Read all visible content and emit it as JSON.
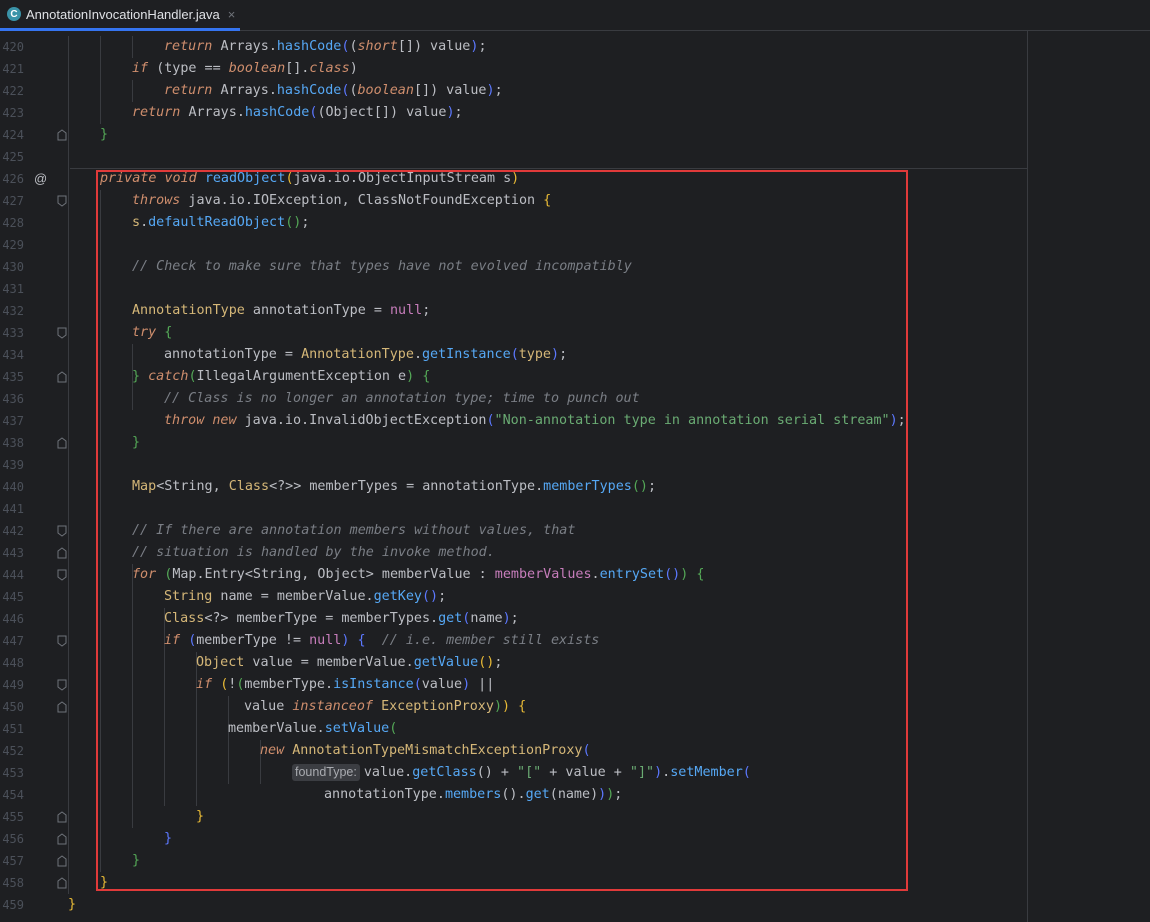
{
  "tab": {
    "label": "AnnotationInvocationHandler.java",
    "icon_letter": "C",
    "close": "×"
  },
  "gutter": {
    "override_marker": "@"
  },
  "inlay": {
    "found_type": "foundType:"
  },
  "lines": [
    {
      "n": "420",
      "indent": 2,
      "tokens": [
        [
          "return",
          "k"
        ],
        [
          " ",
          "i"
        ],
        [
          "Arrays",
          "i"
        ],
        [
          ".",
          "i"
        ],
        [
          "hashCode",
          "f"
        ],
        [
          "(",
          "b2"
        ],
        [
          "(",
          "b3"
        ],
        [
          "short",
          "k"
        ],
        [
          "[]",
          "i"
        ],
        [
          ")",
          "b3"
        ],
        [
          " value",
          ""
        ],
        [
          ")",
          "b2"
        ],
        [
          ";",
          ""
        ]
      ]
    },
    {
      "n": "421",
      "indent": 1,
      "tokens": [
        [
          "if",
          "k"
        ],
        [
          " ",
          "i"
        ],
        [
          "(",
          "b3"
        ],
        [
          "type == ",
          "i"
        ],
        [
          "boolean",
          "k"
        ],
        [
          "[].",
          "i"
        ],
        [
          "class",
          "k"
        ],
        [
          ")",
          "b3"
        ]
      ]
    },
    {
      "n": "422",
      "indent": 2,
      "tokens": [
        [
          "return",
          "k"
        ],
        [
          " ",
          "i"
        ],
        [
          "Arrays",
          "i"
        ],
        [
          ".",
          "i"
        ],
        [
          "hashCode",
          "f"
        ],
        [
          "(",
          "b2"
        ],
        [
          "(",
          "b3"
        ],
        [
          "boolean",
          "k"
        ],
        [
          "[]",
          "i"
        ],
        [
          ")",
          "b3"
        ],
        [
          " value",
          ""
        ],
        [
          ")",
          "b2"
        ],
        [
          ";",
          ""
        ]
      ]
    },
    {
      "n": "423",
      "indent": 1,
      "tokens": [
        [
          "return",
          "k"
        ],
        [
          " ",
          "i"
        ],
        [
          "Arrays",
          "i"
        ],
        [
          ".",
          "i"
        ],
        [
          "hashCode",
          "f"
        ],
        [
          "(",
          "b2"
        ],
        [
          "(",
          "b3"
        ],
        [
          "Object[]",
          "i"
        ],
        [
          ")",
          "b3"
        ],
        [
          " value",
          ""
        ],
        [
          ")",
          "b2"
        ],
        [
          ";",
          ""
        ]
      ]
    },
    {
      "n": "424",
      "indent": 0,
      "tokens": [
        [
          "}",
          "b1"
        ]
      ]
    },
    {
      "n": "425",
      "indent": 0,
      "tokens": []
    },
    {
      "n": "426",
      "indent": 0,
      "tokens": [
        [
          "private",
          "k"
        ],
        [
          " ",
          "i"
        ],
        [
          "void",
          "k"
        ],
        [
          " ",
          "i"
        ],
        [
          "readObject",
          "f"
        ],
        [
          "(",
          "b0"
        ],
        [
          "java.io.ObjectInputStream s",
          "i"
        ],
        [
          ")",
          "b0"
        ]
      ]
    },
    {
      "n": "427",
      "indent": 1,
      "tokens": [
        [
          "throws",
          "k"
        ],
        [
          " java.io.IOException, ClassNotFoundException ",
          "i"
        ],
        [
          "{",
          "b0"
        ]
      ]
    },
    {
      "n": "428",
      "indent": 1,
      "tokens": [
        [
          "s",
          "t"
        ],
        [
          ".",
          "i"
        ],
        [
          "defaultReadObject",
          "f"
        ],
        [
          "()",
          "b1"
        ],
        [
          ";",
          ""
        ]
      ]
    },
    {
      "n": "429",
      "indent": 0,
      "tokens": []
    },
    {
      "n": "430",
      "indent": 1,
      "tokens": [
        [
          "// Check to make sure that types have not evolved incompatibly",
          "c"
        ]
      ]
    },
    {
      "n": "431",
      "indent": 0,
      "tokens": []
    },
    {
      "n": "432",
      "indent": 1,
      "tokens": [
        [
          "AnnotationType",
          "t"
        ],
        [
          " annotationType = ",
          "i"
        ],
        [
          "null",
          "v"
        ],
        [
          ";",
          ""
        ]
      ]
    },
    {
      "n": "433",
      "indent": 1,
      "tokens": [
        [
          "try",
          "k"
        ],
        [
          " ",
          "i"
        ],
        [
          "{",
          "b1"
        ]
      ]
    },
    {
      "n": "434",
      "indent": 2,
      "tokens": [
        [
          "annotationType = ",
          "i"
        ],
        [
          "AnnotationType",
          "t"
        ],
        [
          ".",
          "i"
        ],
        [
          "getInstance",
          "f"
        ],
        [
          "(",
          "b2"
        ],
        [
          "type",
          "t"
        ],
        [
          ")",
          "b2"
        ],
        [
          ";",
          ""
        ]
      ]
    },
    {
      "n": "435",
      "indent": 1,
      "tokens": [
        [
          "}",
          "b1"
        ],
        [
          " ",
          "i"
        ],
        [
          "catch",
          "k"
        ],
        [
          "(",
          "b1"
        ],
        [
          "IllegalArgumentException e",
          "i"
        ],
        [
          ")",
          "b1"
        ],
        [
          " ",
          "i"
        ],
        [
          "{",
          "b1"
        ]
      ]
    },
    {
      "n": "436",
      "indent": 2,
      "tokens": [
        [
          "// Class is no longer an annotation type; time to punch out",
          "c"
        ]
      ]
    },
    {
      "n": "437",
      "indent": 2,
      "tokens": [
        [
          "throw",
          "k"
        ],
        [
          " ",
          "i"
        ],
        [
          "new",
          "k"
        ],
        [
          " java.io.InvalidObjectException",
          "i"
        ],
        [
          "(",
          "b2"
        ],
        [
          "\"Non-annotation type in annotation serial stream\"",
          "s"
        ],
        [
          ")",
          "b2"
        ],
        [
          ";",
          ""
        ]
      ]
    },
    {
      "n": "438",
      "indent": 1,
      "tokens": [
        [
          "}",
          "b1"
        ]
      ]
    },
    {
      "n": "439",
      "indent": 0,
      "tokens": []
    },
    {
      "n": "440",
      "indent": 1,
      "tokens": [
        [
          "Map",
          "t"
        ],
        [
          "<String, ",
          "i"
        ],
        [
          "Class",
          "t"
        ],
        [
          "<?>> memberTypes = annotationType.",
          "i"
        ],
        [
          "memberTypes",
          "f"
        ],
        [
          "()",
          "b1"
        ],
        [
          ";",
          ""
        ]
      ]
    },
    {
      "n": "441",
      "indent": 0,
      "tokens": []
    },
    {
      "n": "442",
      "indent": 1,
      "tokens": [
        [
          "// If there are annotation members without values, that",
          "c"
        ]
      ]
    },
    {
      "n": "443",
      "indent": 1,
      "tokens": [
        [
          "// situation is handled by the invoke method.",
          "c"
        ]
      ]
    },
    {
      "n": "444",
      "indent": 1,
      "tokens": [
        [
          "for",
          "k"
        ],
        [
          " ",
          "i"
        ],
        [
          "(",
          "b1"
        ],
        [
          "Map.Entry<String, Object> memberValue : ",
          "i"
        ],
        [
          "memberValues",
          "v"
        ],
        [
          ".",
          "i"
        ],
        [
          "entrySet",
          "f"
        ],
        [
          "()",
          "b2"
        ],
        [
          ")",
          "b1"
        ],
        [
          " ",
          "i"
        ],
        [
          "{",
          "b1"
        ]
      ]
    },
    {
      "n": "445",
      "indent": 2,
      "tokens": [
        [
          "String",
          "t"
        ],
        [
          " name = memberValue.",
          "i"
        ],
        [
          "getKey",
          "f"
        ],
        [
          "()",
          "b2"
        ],
        [
          ";",
          ""
        ]
      ]
    },
    {
      "n": "446",
      "indent": 2,
      "tokens": [
        [
          "Class",
          "t"
        ],
        [
          "<?> memberType = memberTypes.",
          "i"
        ],
        [
          "get",
          "f"
        ],
        [
          "(",
          "b2"
        ],
        [
          "name",
          "i"
        ],
        [
          ")",
          "b2"
        ],
        [
          ";",
          ""
        ]
      ]
    },
    {
      "n": "447",
      "indent": 2,
      "tokens": [
        [
          "if",
          "k"
        ],
        [
          " ",
          "i"
        ],
        [
          "(",
          "b2"
        ],
        [
          "memberType != ",
          "i"
        ],
        [
          "null",
          "v"
        ],
        [
          ")",
          "b2"
        ],
        [
          " ",
          "i"
        ],
        [
          "{",
          "b2"
        ],
        [
          "  ",
          "i"
        ],
        [
          "// i.e. member still exists",
          "c"
        ]
      ]
    },
    {
      "n": "448",
      "indent": 3,
      "tokens": [
        [
          "Object",
          "t"
        ],
        [
          " value = memberValue.",
          "i"
        ],
        [
          "getValue",
          "f"
        ],
        [
          "()",
          "b0"
        ],
        [
          ";",
          ""
        ]
      ]
    },
    {
      "n": "449",
      "indent": 3,
      "tokens": [
        [
          "if",
          "k"
        ],
        [
          " ",
          "i"
        ],
        [
          "(",
          "b0"
        ],
        [
          "!",
          "i"
        ],
        [
          "(",
          "b1"
        ],
        [
          "memberType.",
          "i"
        ],
        [
          "isInstance",
          "f"
        ],
        [
          "(",
          "b2"
        ],
        [
          "value",
          "i"
        ],
        [
          ")",
          "b2"
        ],
        [
          " ||",
          "i"
        ]
      ]
    },
    {
      "n": "450",
      "indent": 3,
      "extra": 48,
      "tokens": [
        [
          "value ",
          "i"
        ],
        [
          "instanceof",
          "k"
        ],
        [
          " ",
          "i"
        ],
        [
          "ExceptionProxy",
          "t"
        ],
        [
          ")",
          "b1"
        ],
        [
          ")",
          "b0"
        ],
        [
          " ",
          "i"
        ],
        [
          "{",
          "b0"
        ]
      ]
    },
    {
      "n": "451",
      "indent": 4,
      "tokens": [
        [
          "memberValue.",
          "i"
        ],
        [
          "setValue",
          "f"
        ],
        [
          "(",
          "b1"
        ]
      ]
    },
    {
      "n": "452",
      "indent": 5,
      "tokens": [
        [
          "new",
          "k"
        ],
        [
          " ",
          "i"
        ],
        [
          "AnnotationTypeMismatchExceptionProxy",
          "t"
        ],
        [
          "(",
          "b2"
        ]
      ]
    },
    {
      "n": "453",
      "indent": 6,
      "hint": true,
      "tokens": [
        [
          "value.",
          "i"
        ],
        [
          "getClass",
          "f"
        ],
        [
          "()",
          "b3"
        ],
        [
          " + ",
          "i"
        ],
        [
          "\"[\"",
          "s"
        ],
        [
          " + value + ",
          "i"
        ],
        [
          "\"]\"",
          "s"
        ],
        [
          ")",
          "b2"
        ],
        [
          ".",
          "i"
        ],
        [
          "setMember",
          "f"
        ],
        [
          "(",
          "b2"
        ]
      ]
    },
    {
      "n": "454",
      "indent": 7,
      "tokens": [
        [
          "annotationType.",
          "i"
        ],
        [
          "members",
          "f"
        ],
        [
          "()",
          "b3"
        ],
        [
          ".",
          "i"
        ],
        [
          "get",
          "f"
        ],
        [
          "(",
          "b3"
        ],
        [
          "name",
          "i"
        ],
        [
          ")",
          "b3"
        ],
        [
          ")",
          "b2"
        ],
        [
          ")",
          "b1"
        ],
        [
          ";",
          ""
        ]
      ]
    },
    {
      "n": "455",
      "indent": 3,
      "tokens": [
        [
          "}",
          "b0"
        ]
      ]
    },
    {
      "n": "456",
      "indent": 2,
      "tokens": [
        [
          "}",
          "b2"
        ]
      ]
    },
    {
      "n": "457",
      "indent": 1,
      "tokens": [
        [
          "}",
          "b1"
        ]
      ]
    },
    {
      "n": "458",
      "indent": 0,
      "tokens": [
        [
          "}",
          "b0"
        ]
      ]
    },
    {
      "n": "459",
      "indent": -1,
      "tokens": [
        [
          "}",
          "b0"
        ]
      ]
    }
  ]
}
